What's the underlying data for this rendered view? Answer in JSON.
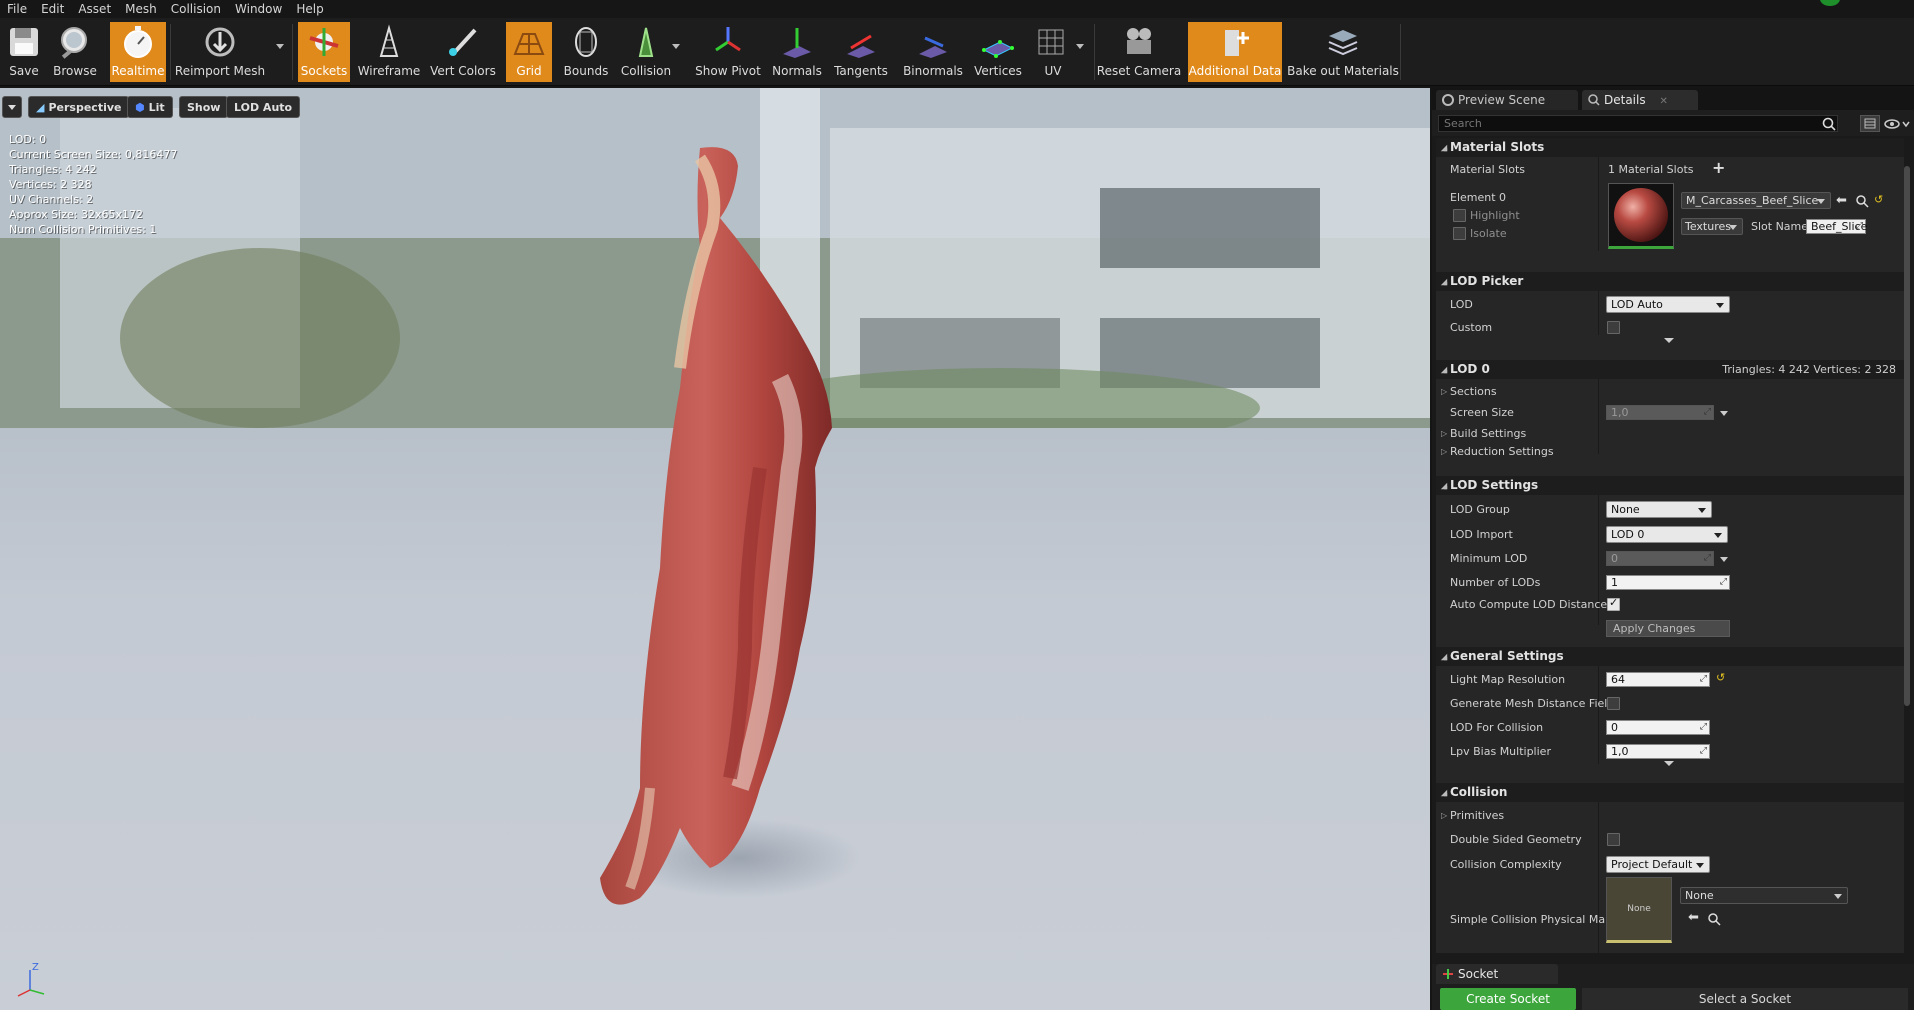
{
  "menu": [
    "File",
    "Edit",
    "Asset",
    "Mesh",
    "Collision",
    "Window",
    "Help"
  ],
  "toolbar": {
    "save": "Save",
    "browse": "Browse",
    "realtime": "Realtime",
    "reimport": "Reimport Mesh",
    "sockets": "Sockets",
    "wireframe": "Wireframe",
    "vert_colors": "Vert Colors",
    "grid": "Grid",
    "bounds": "Bounds",
    "collision": "Collision",
    "show_pivot": "Show Pivot",
    "normals": "Normals",
    "tangents": "Tangents",
    "binormals": "Binormals",
    "vertices": "Vertices",
    "uv": "UV",
    "reset_camera": "Reset Camera",
    "additional_data": "Additional Data",
    "bake_out": "Bake out Materials",
    "active_color": "#e08a1c"
  },
  "viewport": {
    "perspective": "Perspective",
    "lit": "Lit",
    "show": "Show",
    "lod_auto": "LOD Auto",
    "stats": [
      "LOD:  0",
      "Current Screen Size:  0,816477",
      "Triangles:  4 242",
      "Vertices:  2 328",
      "UV Channels:  2",
      "Approx Size: 32x65x172",
      "Num Collision Primitives:  1"
    ],
    "axis_z": "Z"
  },
  "panel": {
    "tab_preview": "Preview Scene Sett",
    "tab_details": "Details",
    "search_placeholder": "Search"
  },
  "material_slots": {
    "header": "Material Slots",
    "label": "Material Slots",
    "count": "1 Material Slots",
    "element": "Element 0",
    "highlight": "Highlight",
    "isolate": "Isolate",
    "material_name": "M_Carcasses_Beef_Slice",
    "textures": "Textures",
    "slot_name_label": "Slot Name",
    "slot_name_value": "Beef_Slice"
  },
  "lod_picker": {
    "header": "LOD Picker",
    "lod_label": "LOD",
    "lod_value": "LOD Auto",
    "custom_label": "Custom"
  },
  "lod0": {
    "header": "LOD 0",
    "summary": "Triangles: 4 242   Vertices: 2 328",
    "sections": "Sections",
    "screen_size_label": "Screen Size",
    "screen_size_value": "1,0",
    "build_settings": "Build Settings",
    "reduction_settings": "Reduction Settings"
  },
  "lod_settings": {
    "header": "LOD Settings",
    "lod_group_label": "LOD Group",
    "lod_group_value": "None",
    "lod_import_label": "LOD Import",
    "lod_import_value": "LOD 0",
    "min_lod_label": "Minimum LOD",
    "min_lod_value": "0",
    "num_lods_label": "Number of LODs",
    "num_lods_value": "1",
    "auto_compute_label": "Auto Compute LOD Distance",
    "apply_changes": "Apply Changes"
  },
  "general_settings": {
    "header": "General Settings",
    "light_map_label": "Light Map Resolution",
    "light_map_value": "64",
    "gen_mesh_dist_label": "Generate Mesh Distance Fiel",
    "lod_collision_label": "LOD For Collision",
    "lod_collision_value": "0",
    "lpv_label": "Lpv Bias Multiplier",
    "lpv_value": "1,0"
  },
  "collision": {
    "header": "Collision",
    "primitives": "Primitives",
    "double_sided_label": "Double Sided Geometry",
    "complexity_label": "Collision Complexity",
    "complexity_value": "Project Default",
    "phys_mat_label": "Simple Collision Physical Ma",
    "phys_mat_thumb": "None",
    "phys_mat_value": "None"
  },
  "socket_manager": {
    "title": "Socket Manager",
    "create": "Create Socket",
    "select": "Select a Socket"
  }
}
